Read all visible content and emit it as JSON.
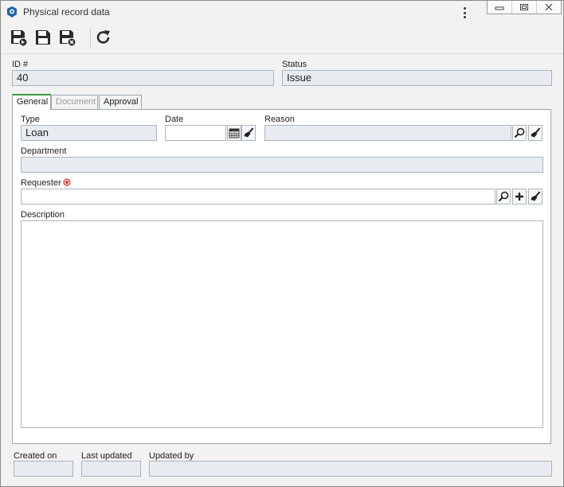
{
  "window": {
    "title": "Physical record data",
    "controls": [
      "minimize",
      "restore",
      "close"
    ]
  },
  "toolbar": {
    "buttons": [
      {
        "name": "save-and-new-icon",
        "tooltip": ""
      },
      {
        "name": "save-icon",
        "tooltip": ""
      },
      {
        "name": "save-and-close-icon",
        "tooltip": ""
      },
      {
        "name": "refresh-icon",
        "tooltip": ""
      }
    ]
  },
  "header": {
    "id_label": "ID #",
    "id_value": "40",
    "status_label": "Status",
    "status_value": "Issue"
  },
  "tabs": [
    {
      "label": "General",
      "active": true
    },
    {
      "label": "Document",
      "active": false,
      "disabled": true
    },
    {
      "label": "Approval",
      "active": false
    }
  ],
  "general": {
    "type_label": "Type",
    "type_value": "Loan",
    "date_label": "Date",
    "date_value": "",
    "reason_label": "Reason",
    "reason_value": "",
    "department_label": "Department",
    "department_value": "",
    "requester_label": "Requester",
    "requester_value": "",
    "description_label": "Description",
    "description_value": ""
  },
  "footer": {
    "created_on_label": "Created on",
    "created_on_value": "",
    "last_updated_label": "Last updated",
    "last_updated_value": "",
    "updated_by_label": "Updated by",
    "updated_by_value": ""
  },
  "colors": {
    "active_tab_accent": "#3f9a3f",
    "required_marker": "#d03030",
    "readonly_field": "#e8ecf0",
    "field_border": "#a8b4c0"
  }
}
